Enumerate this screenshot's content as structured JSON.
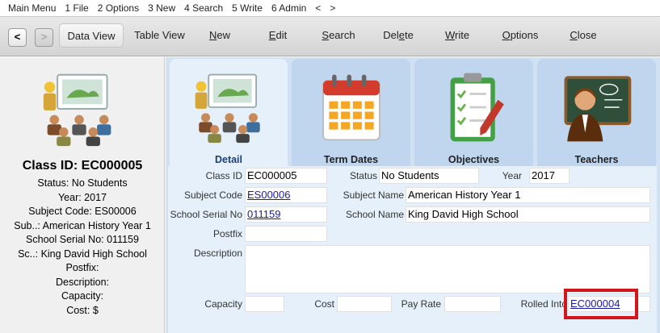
{
  "menu": [
    "Main Menu",
    "1 File",
    "2 Options",
    "3 New",
    "4 Search",
    "5 Write",
    "6 Admin",
    "<",
    ">"
  ],
  "toolbar": {
    "back": "<",
    "forward": ">",
    "data_view": "Data View",
    "table_view": "Table View",
    "new": {
      "f": "N",
      "r": "ew"
    },
    "edit": {
      "f": "E",
      "r": "dit"
    },
    "search": {
      "f": "S",
      "r": "earch"
    },
    "delete": {
      "a": "Del",
      "f": "e",
      "r": "te"
    },
    "write": {
      "f": "W",
      "r": "rite"
    },
    "options": {
      "f": "O",
      "r": "ptions"
    },
    "close": {
      "f": "C",
      "r": "lose"
    }
  },
  "left": {
    "title": "Class ID: EC000005",
    "lines": [
      "Status: No Students",
      "Year: 2017",
      "Subject Code: ES00006",
      "Sub..: American History Year 1",
      "School Serial No: 011159",
      "Sc..: King David High School",
      "Postfix:",
      "Description:",
      "Capacity:",
      "Cost: $"
    ]
  },
  "tabs": [
    "Detail",
    "Term Dates",
    "Objectives",
    "Teachers"
  ],
  "form": {
    "class_id_label": "Class ID",
    "class_id": "EC000005",
    "status_label": "Status",
    "status": "No Students",
    "year_label": "Year",
    "year": "2017",
    "subject_code_label": "Subject Code",
    "subject_code": "ES00006",
    "subject_name_label": "Subject Name",
    "subject_name": "American History Year 1",
    "school_serial_label": "School Serial No",
    "school_serial": "011159",
    "school_name_label": "School Name",
    "school_name": "King David High School",
    "postfix_label": "Postfix",
    "postfix": "",
    "description_label": "Description",
    "description": "",
    "capacity_label": "Capacity",
    "capacity": "",
    "cost_label": "Cost",
    "cost": "",
    "pay_rate_label": "Pay Rate",
    "pay_rate": "",
    "rolled_into_label": "Rolled Into",
    "rolled_into": "EC000004"
  },
  "colors": {
    "highlight": "#d2161b",
    "link": "#1a1aa8",
    "tab_selected": "#e6f0fa",
    "tab": "#bfd6ee"
  }
}
